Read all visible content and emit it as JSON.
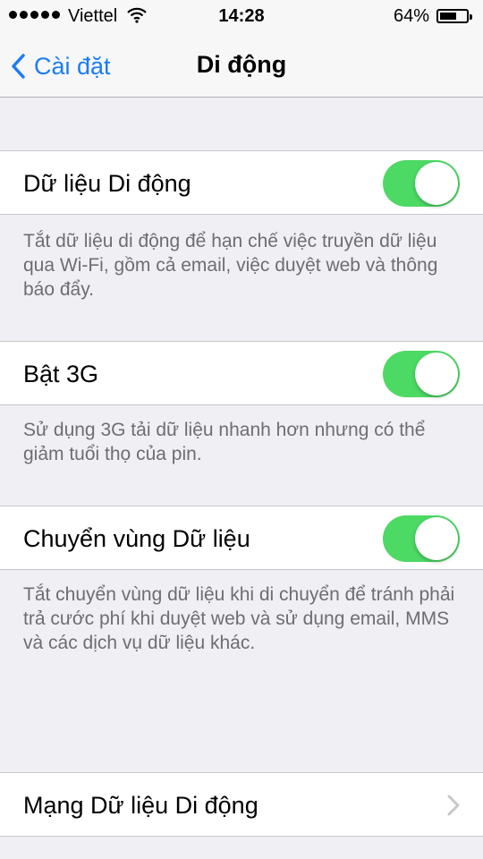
{
  "status": {
    "carrier": "Viettel",
    "time": "14:28",
    "battery": "64%",
    "battery_level": 0.64
  },
  "nav": {
    "back_label": "Cài đặt",
    "title": "Di động"
  },
  "settings": [
    {
      "label": "Dữ liệu Di động",
      "on": true,
      "footer": "Tắt dữ liệu di động để hạn chế việc truyền dữ liệu qua Wi-Fi, gồm cả email, việc duyệt web và thông báo đẩy."
    },
    {
      "label": "Bật 3G",
      "on": true,
      "footer": "Sử dụng 3G tải dữ liệu nhanh hơn nhưng có thể giảm tuổi thọ của pin."
    },
    {
      "label": "Chuyển vùng Dữ liệu",
      "on": true,
      "footer": "Tắt chuyển vùng dữ liệu khi di chuyển để tránh phải trả cước phí khi duyệt web và sử dụng email, MMS và các dịch vụ dữ liệu khác."
    }
  ],
  "network_row": {
    "label": "Mạng Dữ liệu Di động"
  },
  "colors": {
    "accent": "#1a7cf6",
    "toggle_on": "#4cd964",
    "background": "#efeff4"
  }
}
